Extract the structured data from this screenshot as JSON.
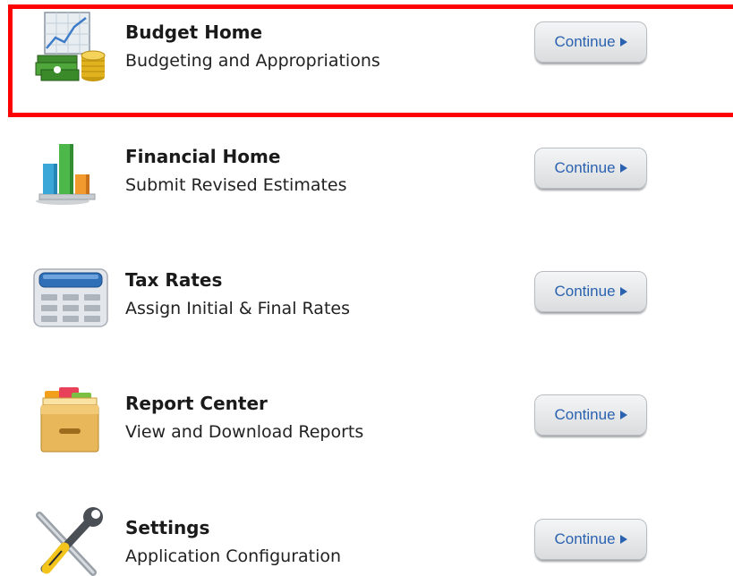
{
  "items": [
    {
      "title": "Budget Home",
      "subtitle": "Budgeting and Appropriations",
      "button": "Continue",
      "icon": "budget-chart-money-icon"
    },
    {
      "title": "Financial Home",
      "subtitle": "Submit Revised Estimates",
      "button": "Continue",
      "icon": "bar-chart-icon"
    },
    {
      "title": "Tax Rates",
      "subtitle": "Assign Initial & Final Rates",
      "button": "Continue",
      "icon": "calculator-icon"
    },
    {
      "title": "Report Center",
      "subtitle": "View and Download Reports",
      "button": "Continue",
      "icon": "file-tray-icon"
    },
    {
      "title": "Settings",
      "subtitle": "Application Configuration",
      "button": "Continue",
      "icon": "tools-icon"
    }
  ],
  "colors": {
    "highlight_frame": "#ff0000",
    "button_text": "#2a62b0"
  },
  "selected_item": "Budget Home"
}
